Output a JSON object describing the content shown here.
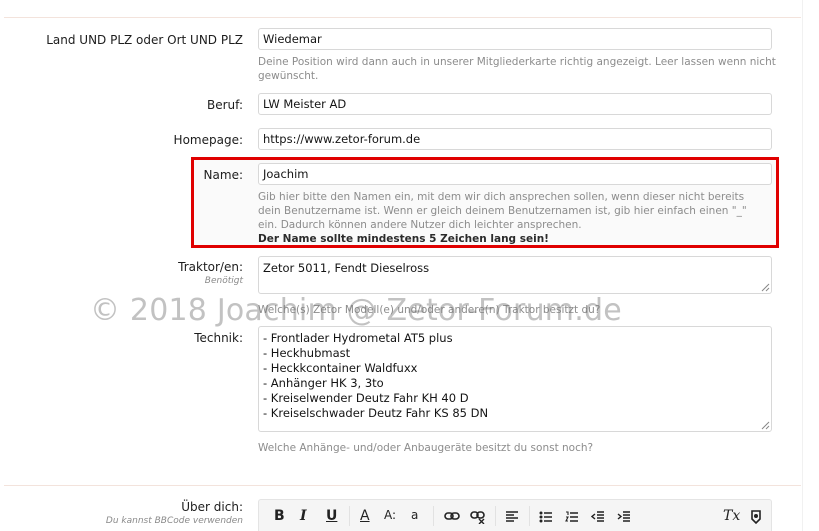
{
  "fields": {
    "location": {
      "label": "Land UND PLZ oder Ort UND PLZ",
      "value": "Wiedemar",
      "hint": "Deine Position wird dann auch in unserer Mitgliederkarte richtig angezeigt. Leer lassen wenn nicht gewünscht."
    },
    "job": {
      "label": "Beruf:",
      "value": "LW Meister AD"
    },
    "homepage": {
      "label": "Homepage:",
      "value": "https://www.zetor-forum.de"
    },
    "name": {
      "label": "Name:",
      "value": "Joachim",
      "hint": "Gib hier bitte den Namen ein, mit dem wir dich ansprechen sollen, wenn dieser nicht bereits dein Benutzername ist. Wenn er gleich deinem Benutzernamen ist, gib hier einfach einen \"_\" ein. Dadurch können andere Nutzer dich leichter ansprechen.",
      "hint_bold": "Der Name sollte mindestens 5 Zeichen lang sein!"
    },
    "tractor": {
      "label": "Traktor/en:",
      "sublabel": "Benötigt",
      "value": "Zetor 5011, Fendt Dieselross",
      "hint": "Welche(s) Zetor Modell(e) und/oder andere(n) Traktor besitzt du?"
    },
    "technik": {
      "label": "Technik:",
      "lines": [
        "- Frontlader Hydrometal AT5 plus",
        "- Heckhubmast",
        "- Heckkcontainer Waldfuxx",
        "- Anhänger HK 3, 3to",
        "- Kreiselwender Deutz Fahr KH 40 D",
        "- Kreiselschwader Deutz Fahr KS 85 DN"
      ],
      "hint": "Welche Anhänge- und/oder Anbaugeräte besitzt du sonst noch?"
    },
    "about": {
      "label": "Über dich:",
      "sublabel": "Du kannst BBCode verwenden"
    }
  },
  "watermark": "© 2018 Joachim @ Zetor-Forum.de",
  "toolbar": {
    "bold": "B",
    "italic": "I",
    "underline": "U",
    "font_color": "A",
    "font_size": "A:",
    "font_family": "a",
    "remove_format": "Tx"
  },
  "colors": {
    "highlight": "#e00000",
    "hint": "#8c8c8c"
  }
}
